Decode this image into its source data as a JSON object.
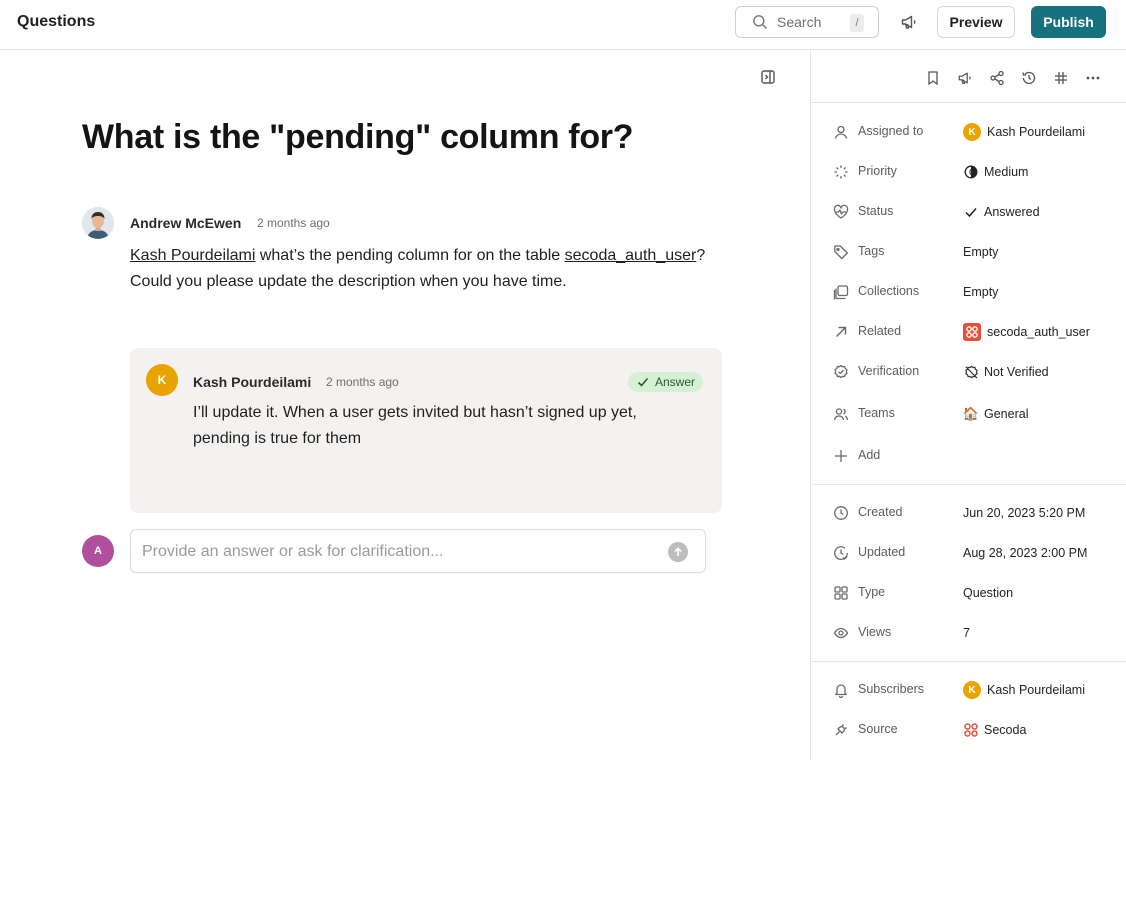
{
  "header": {
    "title": "Questions",
    "search_label": "Search",
    "search_shortcut": "/",
    "preview_label": "Preview",
    "publish_label": "Publish"
  },
  "question": {
    "title": "What is the \"pending\" column for?",
    "author": "Andrew McEwen",
    "time": "2 months ago",
    "mention": "Kash Pourdeilami",
    "body_part1": " what’s the pending column for on the table ",
    "table_ref": "secoda_auth_user",
    "body_part2": "? Could you please update the description when you have time."
  },
  "answer": {
    "avatar_initial": "K",
    "author": "Kash Pourdeilami",
    "time": "2 months ago",
    "badge_label": "Answer",
    "body": "I’ll update it. When a user gets invited but hasn’t signed up yet, pending is true for them"
  },
  "reply": {
    "avatar_initial": "A",
    "placeholder": "Provide an answer or ask for clarification..."
  },
  "properties": {
    "assigned_to": {
      "label": "Assigned to",
      "initial": "K",
      "value": "Kash Pourdeilami"
    },
    "priority": {
      "label": "Priority",
      "value": "Medium"
    },
    "status": {
      "label": "Status",
      "value": "Answered"
    },
    "tags": {
      "label": "Tags",
      "value": "Empty"
    },
    "collections": {
      "label": "Collections",
      "value": "Empty"
    },
    "related": {
      "label": "Related",
      "value": "secoda_auth_user"
    },
    "verification": {
      "label": "Verification",
      "value": "Not Verified"
    },
    "teams": {
      "label": "Teams",
      "emoji": "🏠",
      "value": "General"
    },
    "add_label": "Add"
  },
  "metadata": {
    "created": {
      "label": "Created",
      "value": "Jun 20, 2023 5:20 PM"
    },
    "updated": {
      "label": "Updated",
      "value": "Aug 28, 2023 2:00 PM"
    },
    "type": {
      "label": "Type",
      "value": "Question"
    },
    "views": {
      "label": "Views",
      "value": "7"
    }
  },
  "footer_props": {
    "subscribers": {
      "label": "Subscribers",
      "initial": "K",
      "value": "Kash Pourdeilami"
    },
    "source": {
      "label": "Source",
      "value": "Secoda"
    }
  },
  "colors": {
    "publish": "#17727f",
    "answer_badge_bg": "#d6f0d4",
    "answer_card_bg": "#f3f2f0",
    "avatar_k": "#e9a400",
    "avatar_a": "#b04f9c",
    "secoda_red": "#e54e3a"
  }
}
